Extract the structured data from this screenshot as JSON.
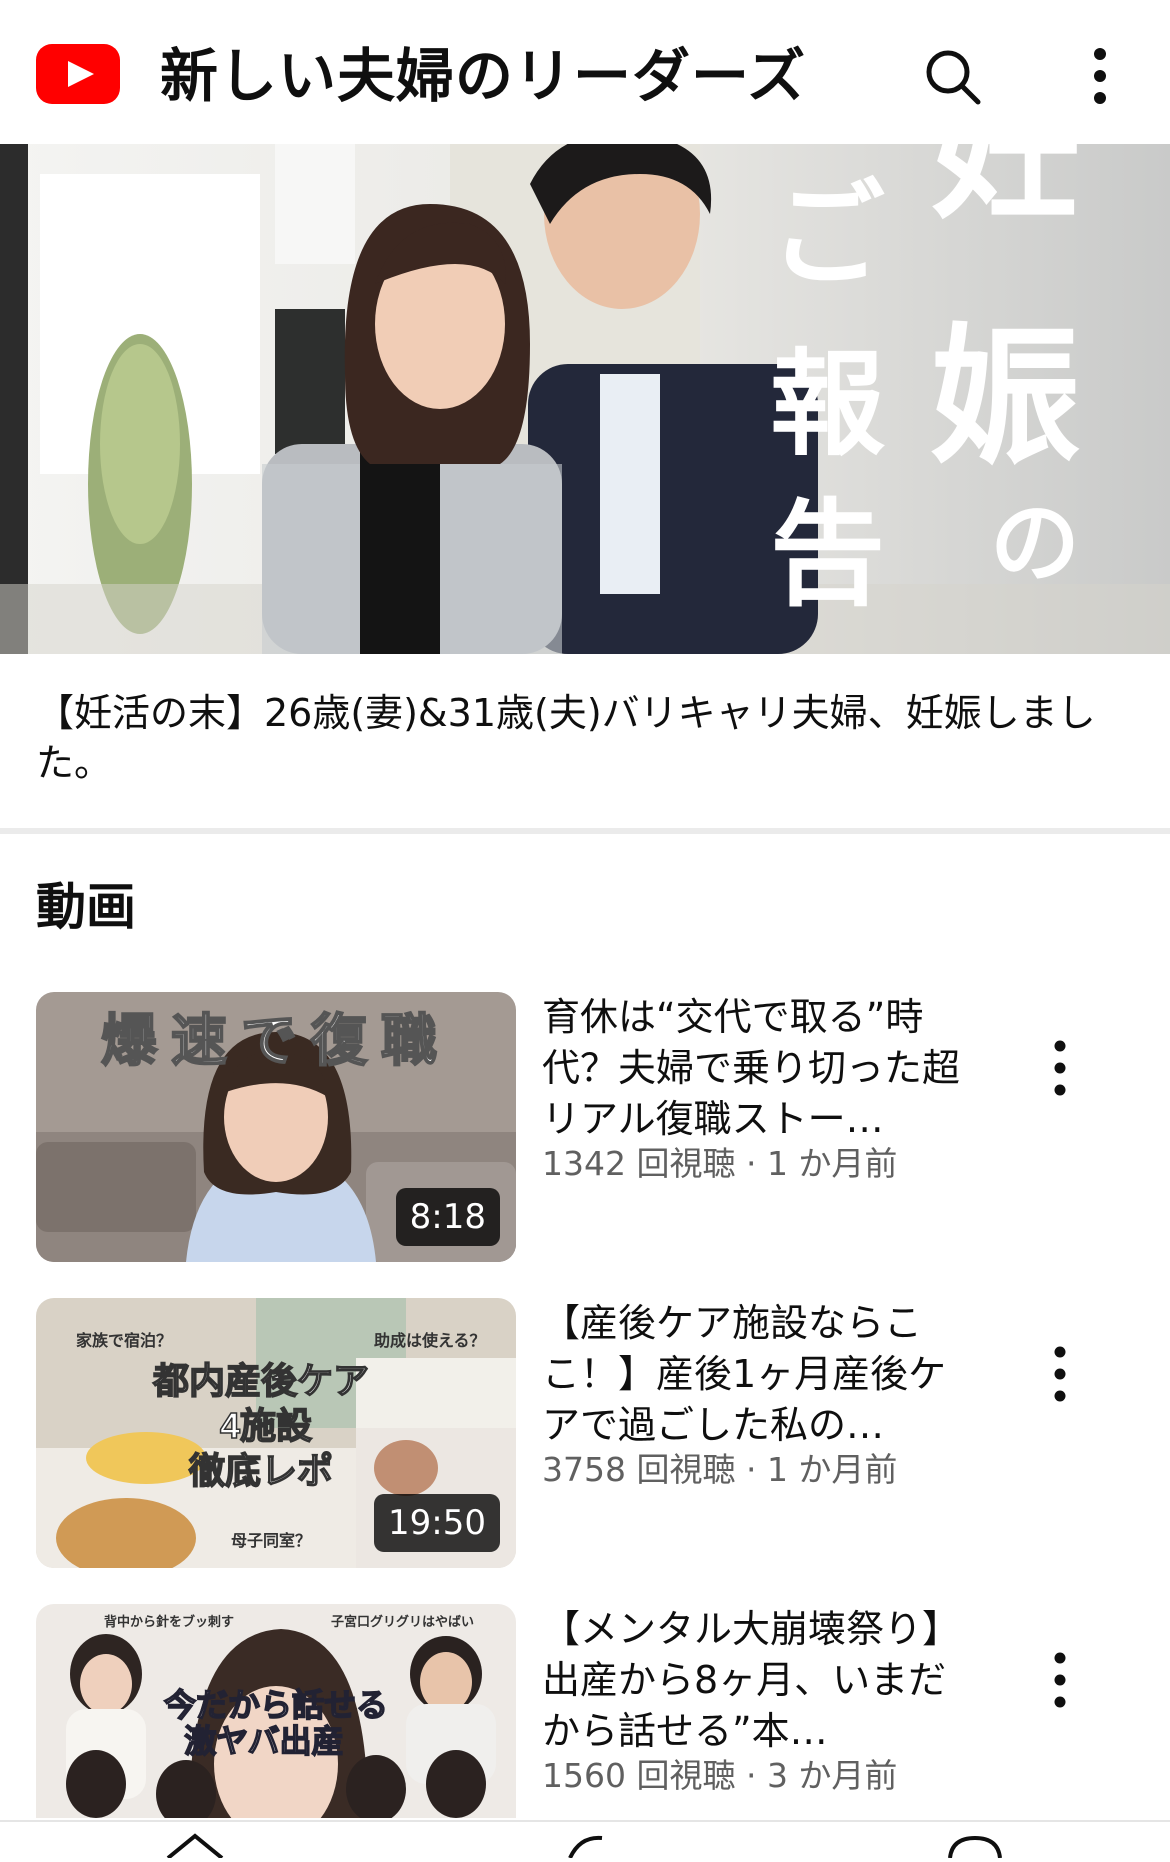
{
  "app": {
    "channel_title": "新しい夫婦のリーダーズ",
    "brand_color": "#ff0000"
  },
  "header": {
    "search_icon": "search-icon",
    "more_icon": "more-vert-icon"
  },
  "banner": {
    "overlay_text_main": "妊娠",
    "overlay_text_sub": "ご報告",
    "overlay_text_no": "の",
    "caption": "【妊活の末】26歳(妻)&31歳(夫)バリキャリ夫婦、妊娠しました。"
  },
  "videos_section": {
    "title": "動画",
    "items": [
      {
        "thumb_text": "爆速で復職",
        "duration": "8:18",
        "title": "育休は“交代で取る”時代？夫婦で乗り切った超リアル復職ストー…",
        "meta": "1342 回視聴 · 1 か月前"
      },
      {
        "thumb_text_1": "都内産後ケア",
        "thumb_text_2": "4施設",
        "thumb_text_3": "徹底レポ",
        "thumb_tag_1": "家族で宿泊？",
        "thumb_tag_2": "助成は使える？",
        "thumb_tag_3": "母子同室？",
        "duration": "19:50",
        "title": "【産後ケア施設ならここ！】産後1ヶ月産後ケアで過ごした私の…",
        "meta": "3758 回視聴 · 1 か月前"
      },
      {
        "thumb_text_1": "今だから話せる",
        "thumb_text_2": "激ヤバ出産",
        "thumb_tag_1": "背中から針をブッ刺す",
        "thumb_tag_2": "子宮口グリグリはやばい",
        "duration": "",
        "title": "【メンタル大崩壊祭り】出産から8ヶ月、いまだから話せる”本…",
        "meta": "1560 回視聴 · 3 か月前"
      }
    ]
  }
}
